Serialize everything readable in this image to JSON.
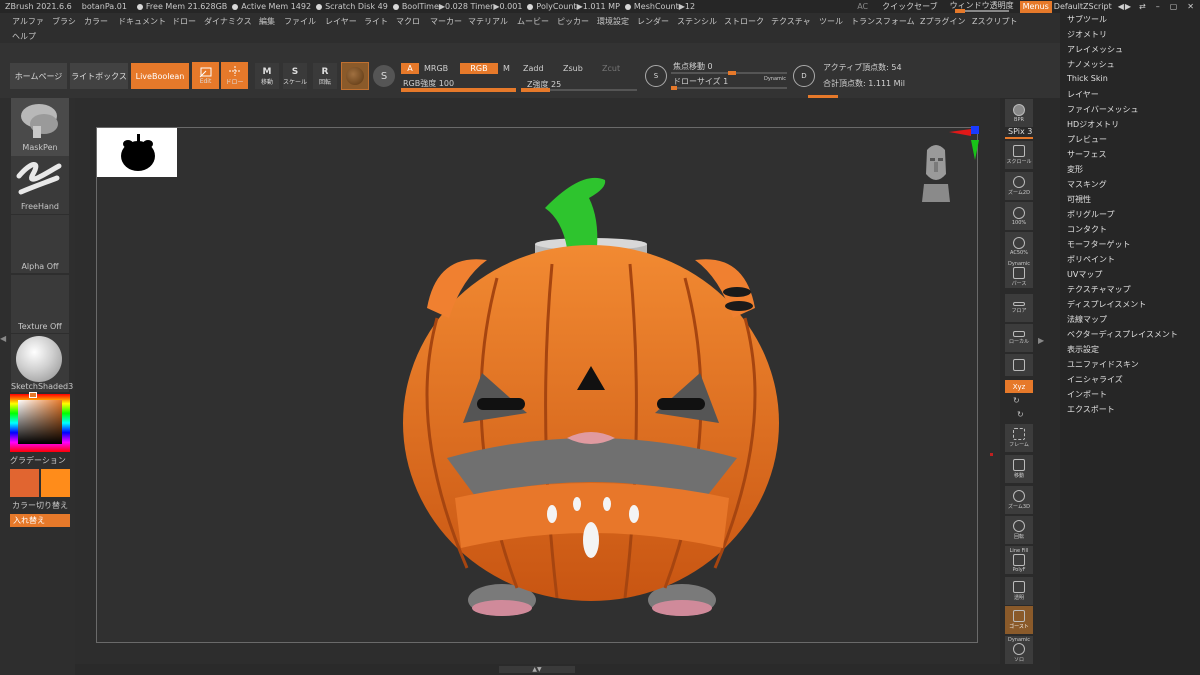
{
  "titlebar": {
    "app": "ZBrush 2021.6.6",
    "doc": "botanPa.01",
    "free_mem": "Free Mem 21.628GB",
    "active_mem": "Active Mem 1492",
    "scratch": "Scratch Disk 49",
    "booltime": "BoolTime▶0.028 Timer▶0.001",
    "polycount": "PolyCount▶1.011 MP",
    "meshcount": "MeshCount▶12",
    "ac": "AC",
    "quicksave": "クイックセーブ",
    "transparency": "ウィンドウ透明度",
    "menus": "Menus",
    "script": "DefaultZScript"
  },
  "menubar": {
    "row1": [
      "アルファ",
      "ブラシ",
      "カラー",
      "ドキュメント",
      "ドロー",
      "ダイナミクス",
      "編集",
      "ファイル",
      "レイヤー",
      "ライト",
      "マクロ",
      "マーカー",
      "マテリアル",
      "ムービー",
      "ピッカー",
      "環境設定",
      "レンダー",
      "ステンシル",
      "ストローク",
      "テクスチャ",
      "ツール",
      "トランスフォーム",
      "Zプラグイン",
      "Zスクリプト"
    ],
    "row2": [
      "ヘルプ"
    ]
  },
  "shelf": {
    "home": "ホームページ",
    "lightbox": "ライトボックス",
    "liveboolean": "LiveBoolean",
    "edit": "Edit",
    "draw": "ドロー",
    "move": "移動",
    "scale": "スケール",
    "rotate": "回転",
    "a": "A",
    "mrgb": "MRGB",
    "rgb": "RGB",
    "m": "M",
    "rgb_intensity": "RGB強度 100",
    "zadd": "Zadd",
    "zsub": "Zsub",
    "zcut": "Zcut",
    "z_intensity": "Z強度 25",
    "focal": "焦点移動 0",
    "draw_size": "ドローサイズ 1",
    "dynamic": "Dynamic",
    "active_points": "アクティブ頂点数: 54",
    "total_points": "合計頂点数: 1.111 Mil"
  },
  "left": {
    "brush": "MaskPen",
    "stroke": "FreeHand",
    "alpha": "Alpha Off",
    "texture": "Texture Off",
    "material": "SketchShaded3",
    "gradient": "グラデーション",
    "switch_color": "カラー切り替え",
    "swap": "入れ替え"
  },
  "right_toolbar": {
    "bpr": "BPR",
    "spix": "SPix 3",
    "scroll": "スクロール",
    "zoom2d": "ズーム2D",
    "actual": "100%",
    "aahalf": "AC50%",
    "dynamic": "Dynamic",
    "persp": "パース",
    "floor": "フロア",
    "local": "ローカル",
    "xyz": "Xyz",
    "frame": "フレーム",
    "move": "移動",
    "zoom3d": "ズーム3D",
    "rotate": "回転",
    "linefill": "Line Fill",
    "polyf": "PolyF",
    "transp": "透明",
    "ghost": "ゴースト",
    "solo": "ソロ",
    "solo_dynamic": "Dynamic"
  },
  "right_menu": [
    "サブツール",
    "ジオメトリ",
    "アレイメッシュ",
    "ナノメッシュ",
    "Thick Skin",
    "レイヤー",
    "ファイバーメッシュ",
    "HDジオメトリ",
    "プレビュー",
    "サーフェス",
    "変形",
    "マスキング",
    "可視性",
    "ポリグループ",
    "コンタクト",
    "モーフターゲット",
    "ポリペイント",
    "UVマップ",
    "テクスチャマップ",
    "ディスプレイスメント",
    "法線マップ",
    "ベクターディスプレイスメント",
    "表示設定",
    "ユニファイドスキン",
    "イニシャライズ",
    "インポート",
    "エクスポート"
  ],
  "colors": {
    "accent": "#e6792a",
    "pumpkin": "#e8782a",
    "stem": "#2ec42e"
  }
}
